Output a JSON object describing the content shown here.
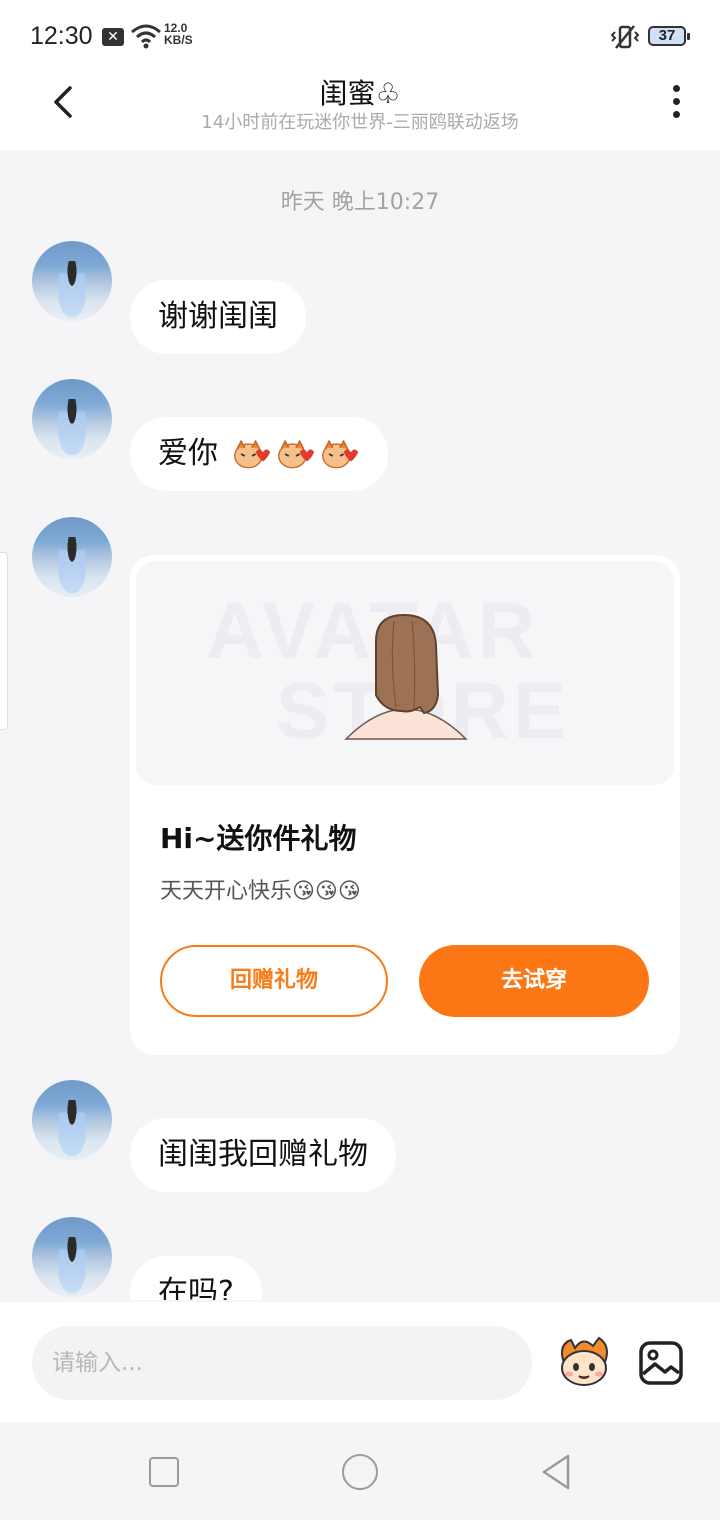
{
  "status_bar": {
    "time": "12:30",
    "speed_value": "12.0",
    "speed_unit": "KB/S",
    "battery": "37"
  },
  "header": {
    "title": "闺蜜♧",
    "subtitle": "14小时前在玩迷你世界-三丽鸥联动返场"
  },
  "chat": {
    "timestamp": "昨天 晚上10:27",
    "messages": [
      {
        "text": "谢谢闺闺"
      },
      {
        "text": "爱你"
      },
      {
        "text": "闺闺我回赠礼物"
      },
      {
        "text": "在吗?"
      }
    ],
    "gift_card": {
      "watermark_line1": "AVATAR",
      "watermark_line2": "STORE",
      "title": "Hi~送你件礼物",
      "subtitle": "天天开心快乐😘😘😘",
      "button_return": "回赠礼物",
      "button_try": "去试穿"
    }
  },
  "input": {
    "placeholder": "请输入..."
  },
  "colors": {
    "accent": "#fb7614",
    "background": "#f5f5f7"
  },
  "icons": [
    "back-arrow-icon",
    "more-vertical-icon",
    "mascot-emoji-icon",
    "image-icon"
  ]
}
